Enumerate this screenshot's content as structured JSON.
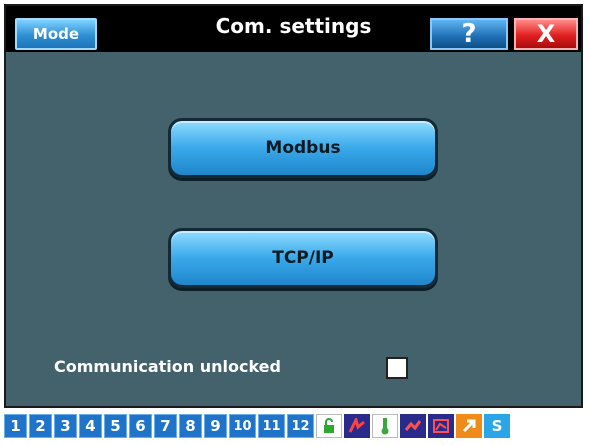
{
  "header": {
    "mode_label": "Mode",
    "title": "Com. settings",
    "help_label": "?",
    "close_label": "X"
  },
  "buttons": {
    "modbus": "Modbus",
    "tcpip": "TCP/IP"
  },
  "unlock": {
    "label": "Communication unlocked",
    "checked": false
  },
  "taskbar": {
    "numbers": [
      "1",
      "2",
      "3",
      "4",
      "5",
      "6",
      "7",
      "8",
      "9",
      "10",
      "11",
      "12"
    ],
    "status_icons": [
      "lock-icon",
      "alarm-icon",
      "thermometer-icon",
      "link-icon",
      "chart-icon",
      "arrow-icon",
      "s-icon"
    ],
    "s_label": "S"
  },
  "colors": {
    "background": "#43626c",
    "accent_blue": "#39a9ea",
    "close_red": "#e22020"
  }
}
